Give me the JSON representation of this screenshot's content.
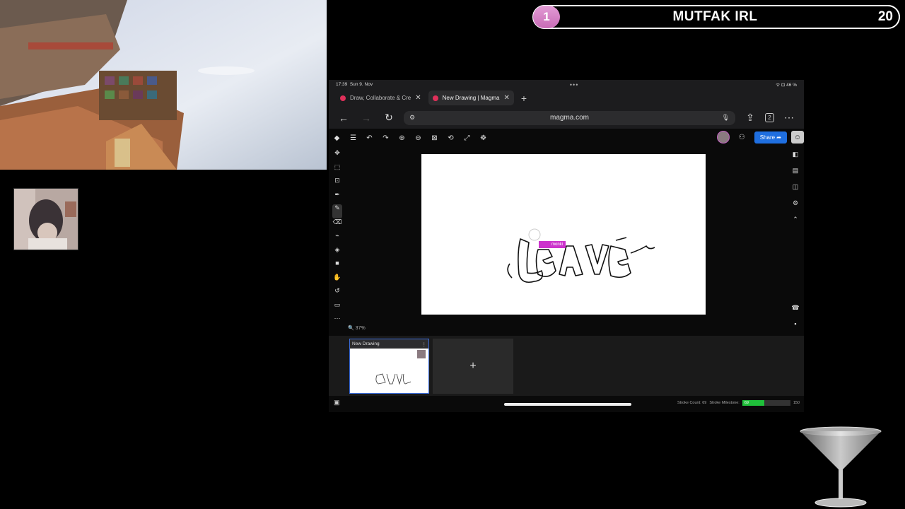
{
  "banner": {
    "rank": "1",
    "title": "MUTFAK IRL",
    "count": "20"
  },
  "statusbar": {
    "time": "17:39",
    "date": "Sun 9. Nov",
    "indicators": "ᯤ ⊡ 46 %"
  },
  "tabs": [
    {
      "label": "Draw, Collaborate & Cre",
      "close": "✕",
      "active": false
    },
    {
      "label": "New Drawing | Magma",
      "close": "✕",
      "active": true
    }
  ],
  "addressbar": {
    "url": "magma.com",
    "tab_count": "2"
  },
  "toolbar": {
    "share_label": "Share"
  },
  "canvas": {
    "drawing_text": "LEAVE",
    "cursor_user": "monki"
  },
  "zoom": "37%",
  "frames": [
    {
      "title": "New Drawing"
    }
  ],
  "add_frame_label": "+",
  "stats": {
    "stroke_count_label": "Stroke Count: 69",
    "milestone_label": "Stroke Milestone:",
    "progress_value": "69",
    "milestone_target": "150",
    "progress_fraction": 0.46
  },
  "colors": {
    "accent": "#1f6fe0",
    "cursor_tag": "#cc33cc",
    "progress": "#1fbf3a",
    "banner_rank": "#d07ac2"
  }
}
